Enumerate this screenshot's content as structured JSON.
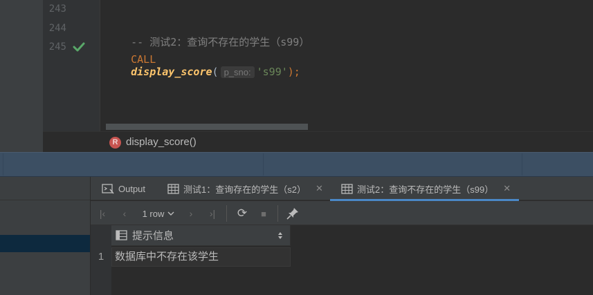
{
  "editor": {
    "lines": [
      {
        "number": "243"
      },
      {
        "number": "244",
        "comment": "-- 测试2：查询不存在的学生（s99）"
      },
      {
        "number": "245",
        "keyword": "CALL",
        "function": "display_score",
        "open_paren": "(",
        "param_hint": "p_sno:",
        "argument": "'s99'",
        "close": ");"
      }
    ],
    "breadcrumb": {
      "badge": "R",
      "label": "display_score()"
    }
  },
  "results": {
    "tabs": [
      {
        "label": "Output",
        "icon": "output-icon"
      },
      {
        "label": "测试1：查询存在的学生（s2）",
        "icon": "table-icon",
        "close": "✕"
      },
      {
        "label": "测试2：查询不存在的学生（s99）",
        "icon": "table-icon",
        "close": "✕",
        "active": true
      }
    ],
    "toolbar": {
      "first": "|‹",
      "prev": "‹",
      "row_count": "1 row",
      "next": "›",
      "last": "›|",
      "refresh": "⟳",
      "stop": "■",
      "pin": "📌"
    },
    "columns": [
      "提示信息"
    ],
    "rows": [
      {
        "index": "1",
        "values": [
          "数据库中不存在该学生"
        ]
      }
    ]
  },
  "colors": {
    "accent": "#4a88c7",
    "keyword": "#cc7832",
    "function": "#ffc66d",
    "string": "#6a8759",
    "comment": "#808080",
    "success": "#59a869"
  }
}
